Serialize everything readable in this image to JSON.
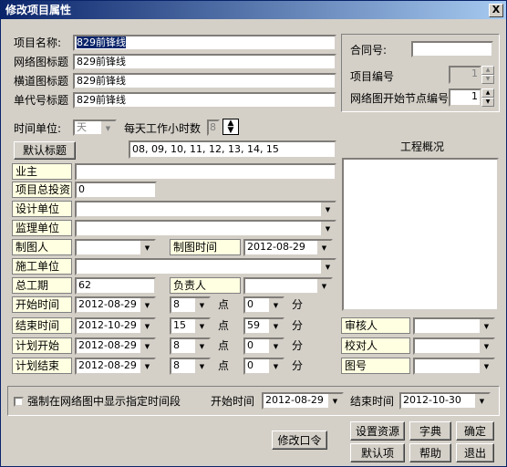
{
  "window": {
    "title": "修改项目属性",
    "close_label": "X"
  },
  "project": {
    "name_label": "项目名称:",
    "name_value": "829前锋线",
    "net_title_label": "网络图标题",
    "net_title_value": "829前锋线",
    "bar_title_label": "横道图标题",
    "bar_title_value": "829前锋线",
    "code_title_label": "单代号标题",
    "code_title_value": "829前锋线"
  },
  "right_top": {
    "contract_label": "合同号:",
    "contract_value": "",
    "project_no_label": "项目编号",
    "project_no_value": "1",
    "start_node_label": "网络图开始节点编号",
    "start_node_value": "1"
  },
  "time": {
    "unit_label": "时间单位:",
    "unit_value": "天",
    "hours_label": "每天工作小时数",
    "hours_value": "8"
  },
  "default_title_button": "默认标题",
  "hours_list": "08, 09, 10, 11, 12, 13, 14, 15",
  "overview_label": "工程概况",
  "fields": {
    "owner_label": "业主",
    "owner_value": "",
    "investment_label": "项目总投资",
    "investment_value": "0",
    "design_label": "设计单位",
    "design_value": "",
    "supervise_label": "监理单位",
    "supervise_value": "",
    "drafter_label": "制图人",
    "drafter_value": "",
    "draw_time_label": "制图时间",
    "draw_time_value": "2012-08-29",
    "construct_label": "施工单位",
    "construct_value": "",
    "duration_label": "总工期",
    "duration_value": "62",
    "manager_label": "负责人",
    "manager_value": ""
  },
  "schedule": [
    {
      "label": "开始时间",
      "date": "2012-08-29",
      "hour": "8",
      "hour_unit": "点",
      "minute": "0",
      "minute_unit": "分"
    },
    {
      "label": "结束时间",
      "date": "2012-10-29",
      "hour": "15",
      "hour_unit": "点",
      "minute": "59",
      "minute_unit": "分"
    },
    {
      "label": "计划开始",
      "date": "2012-08-29",
      "hour": "8",
      "hour_unit": "点",
      "minute": "0",
      "minute_unit": "分"
    },
    {
      "label": "计划结束",
      "date": "2012-08-29",
      "hour": "8",
      "hour_unit": "点",
      "minute": "0",
      "minute_unit": "分"
    }
  ],
  "review": {
    "reviewer_label": "审核人",
    "reviewer_value": "",
    "checker_label": "校对人",
    "checker_value": "",
    "figure_no_label": "图号",
    "figure_no_value": ""
  },
  "force_display": {
    "label": "强制在网络图中显示指定时间段",
    "start_label": "开始时间",
    "start_value": "2012-08-29",
    "end_label": "结束时间",
    "end_value": "2012-10-30"
  },
  "buttons": {
    "change_password": "修改口令",
    "set_resource": "设置资源",
    "dictionary": "字典",
    "ok": "确定",
    "default": "默认项",
    "help": "帮助",
    "exit": "退出"
  }
}
